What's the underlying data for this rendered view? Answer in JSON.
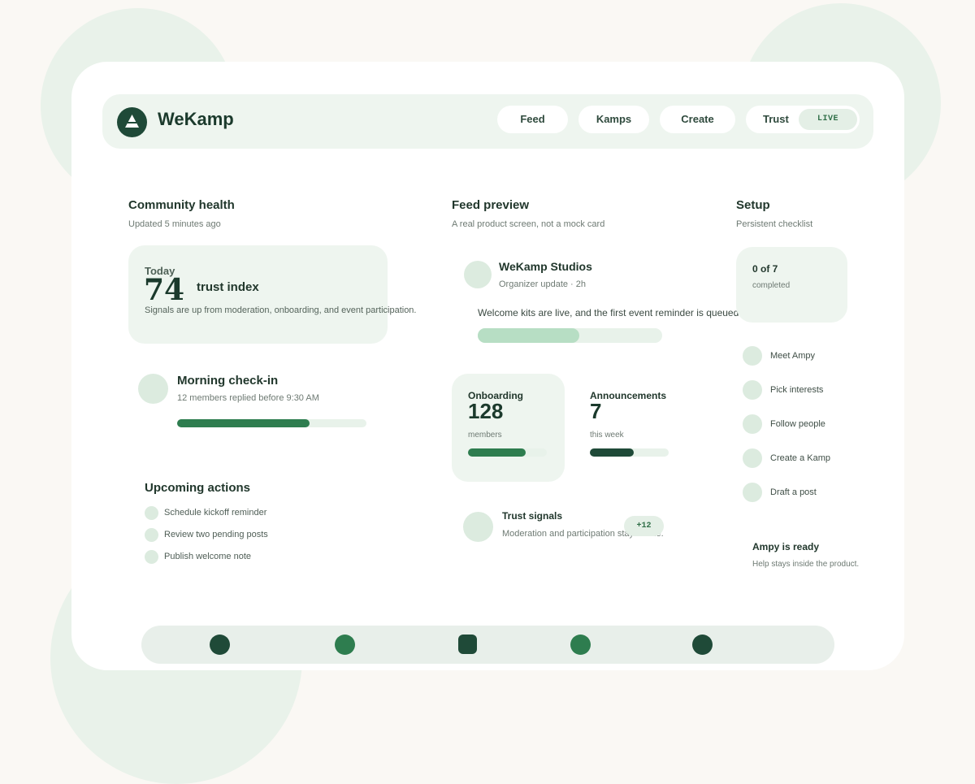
{
  "app": {
    "name": "WeKamp"
  },
  "nav": {
    "items": [
      {
        "label": "Feed"
      },
      {
        "label": "Kamps"
      },
      {
        "label": "Create"
      },
      {
        "label": "Trust",
        "badge": "LIVE"
      }
    ]
  },
  "community": {
    "title": "Community health",
    "subtitle": "Updated 5 minutes ago",
    "trust": {
      "today_label": "Today",
      "value": "74",
      "label": "trust index",
      "description": "Signals are up from moderation, onboarding, and event participation."
    },
    "checkin": {
      "title": "Morning check-in",
      "subtitle": "12 members replied before 9:30 AM",
      "progress": 0.7
    },
    "upcoming": {
      "title": "Upcoming actions",
      "items": [
        {
          "label": "Schedule kickoff reminder"
        },
        {
          "label": "Review two pending posts"
        },
        {
          "label": "Publish welcome note"
        }
      ]
    }
  },
  "feed": {
    "title": "Feed preview",
    "subtitle": "A real product screen, not a mock card",
    "post": {
      "author": "WeKamp Studios",
      "meta": "Organizer update · 2h",
      "body": "Welcome kits are live, and the first event reminder is queued.",
      "progress": 0.55
    },
    "stats": [
      {
        "title": "Onboarding",
        "value": "128",
        "unit": "members",
        "progress": 0.73
      },
      {
        "title": "Announcements",
        "value": "7",
        "unit": "this week",
        "progress": 0.56
      }
    ],
    "signals": {
      "title": "Trust signals",
      "subtitle": "Moderation and participation stay visible.",
      "badge": "+12"
    }
  },
  "setup": {
    "title": "Setup",
    "subtitle": "Persistent checklist",
    "count": "0 of 7",
    "count_label": "completed",
    "items": [
      {
        "label": "Meet Ampy"
      },
      {
        "label": "Pick interests"
      },
      {
        "label": "Follow people"
      },
      {
        "label": "Create a Kamp"
      },
      {
        "label": "Draft a post"
      }
    ],
    "ampy": {
      "title": "Ampy is ready",
      "subtitle": "Help stays inside the product."
    }
  },
  "colors": {
    "accent_dark": "#1f4a38",
    "accent": "#2e7d4f",
    "accent_light": "#b7dec4",
    "surface": "#eef5ef"
  },
  "bottom_nav": {
    "icons": [
      "home-icon",
      "feed-icon",
      "kamps-icon",
      "create-icon",
      "profile-icon"
    ]
  }
}
